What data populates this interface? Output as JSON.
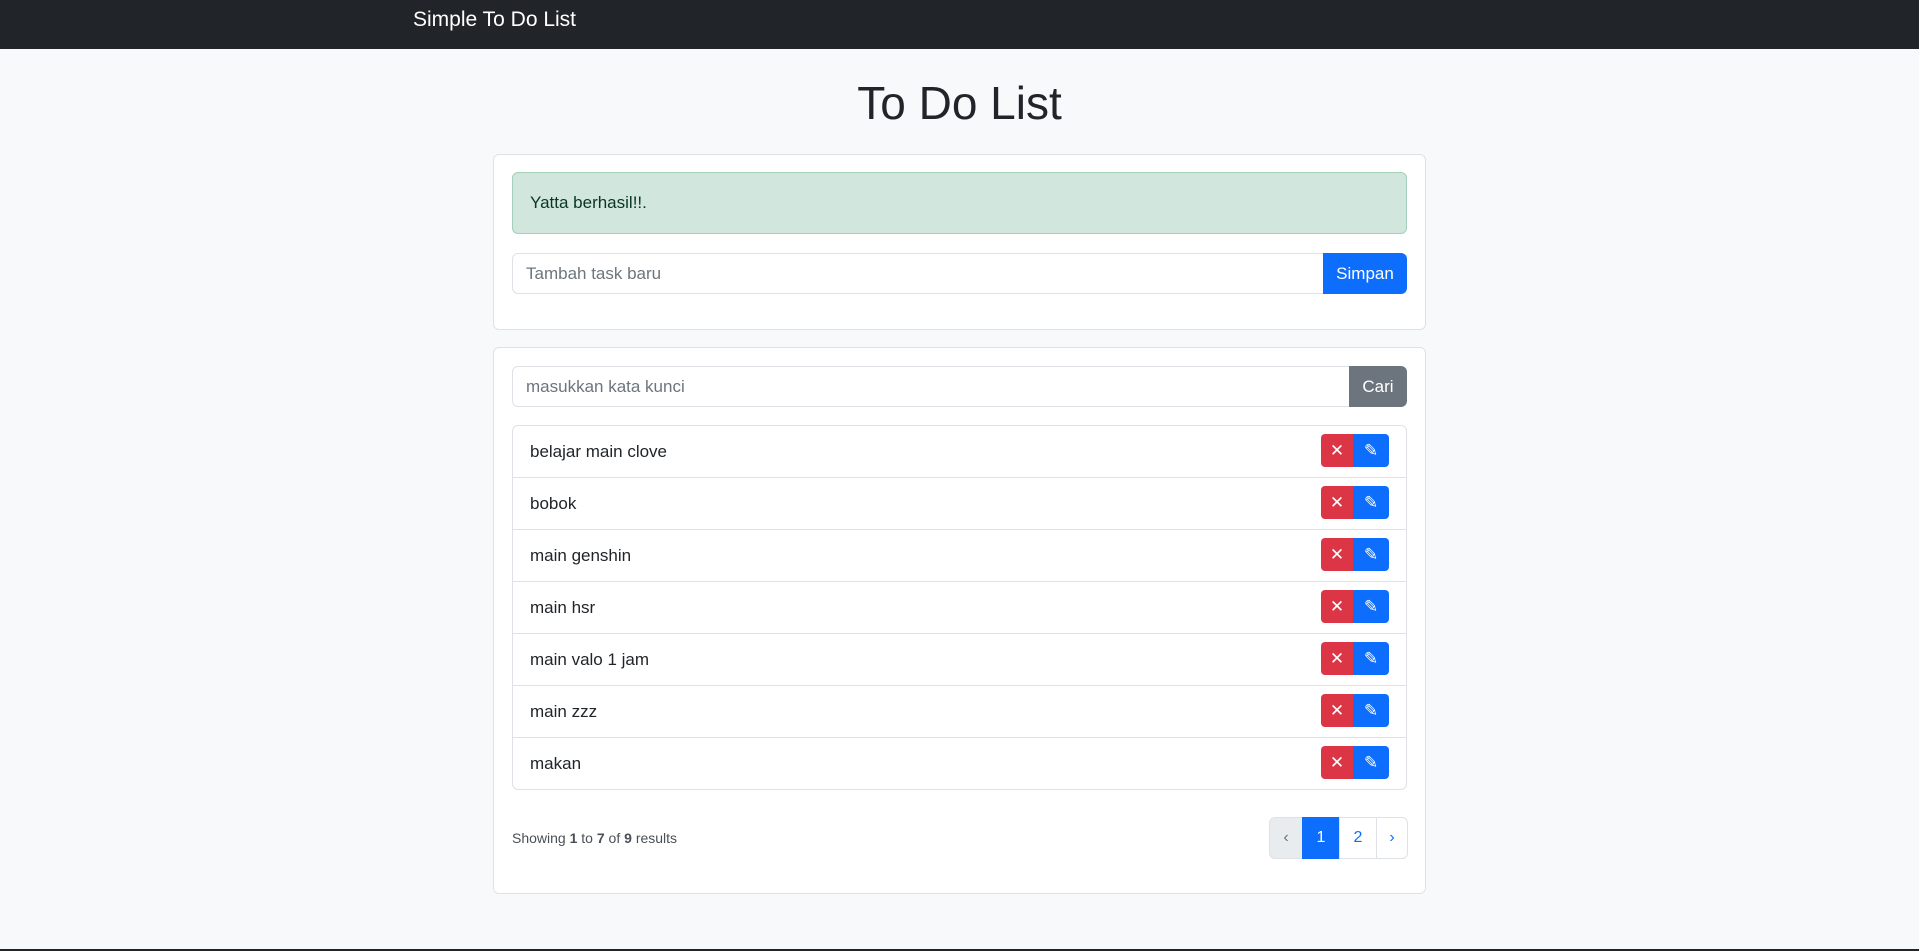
{
  "navbar": {
    "brand": "Simple To Do List"
  },
  "page": {
    "title": "To Do List"
  },
  "add_card": {
    "alert": "Yatta berhasil!!.",
    "input_placeholder": "Tambah task baru",
    "submit_label": "Simpan"
  },
  "list_card": {
    "search_placeholder": "masukkan kata kunci",
    "search_label": "Cari",
    "tasks": [
      {
        "title": "belajar main clove"
      },
      {
        "title": "bobok"
      },
      {
        "title": "main genshin"
      },
      {
        "title": "main hsr"
      },
      {
        "title": "main valo 1 jam"
      },
      {
        "title": "main zzz"
      },
      {
        "title": "makan"
      }
    ],
    "delete_icon": "close-icon",
    "edit_icon": "pencil-icon",
    "delete_glyph": "✕",
    "edit_glyph": "✎",
    "results": {
      "prefix": "Showing",
      "from": "1",
      "to_word": "to",
      "to": "7",
      "of_word": "of",
      "total": "9",
      "suffix": "results"
    },
    "pagination": {
      "prev": "‹",
      "pages": [
        "1",
        "2"
      ],
      "current": "1",
      "next": "›"
    }
  },
  "colors": {
    "navbar": "#212529",
    "primary": "#0d6efd",
    "danger": "#dc3545",
    "secondary": "#6c757d",
    "success_bg": "#d1e7dd"
  }
}
